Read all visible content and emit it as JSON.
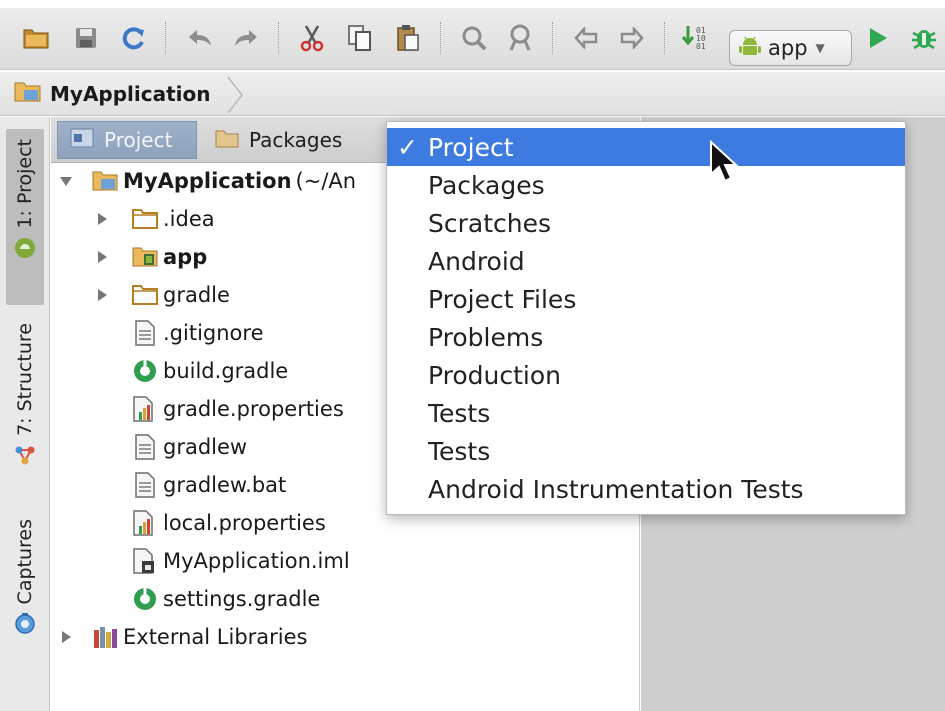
{
  "toolbar": {
    "buttons": [
      {
        "name": "open-folder-icon"
      },
      {
        "name": "save-icon"
      },
      {
        "name": "sync-icon"
      },
      {
        "name": "undo-icon"
      },
      {
        "name": "redo-icon"
      },
      {
        "name": "cut-icon"
      },
      {
        "name": "copy-icon"
      },
      {
        "name": "paste-icon"
      },
      {
        "name": "find-icon"
      },
      {
        "name": "replace-icon"
      },
      {
        "name": "back-icon"
      },
      {
        "name": "forward-icon"
      },
      {
        "name": "make-project-icon"
      }
    ],
    "run_config": {
      "label": "app",
      "icon": "android-icon"
    },
    "run_icon": "run-icon",
    "debug_icon": "debug-icon"
  },
  "breadcrumb": {
    "label": "MyApplication"
  },
  "tool_strip": {
    "tabs": [
      {
        "label": "1: Project",
        "icon": "android-icon",
        "active": true
      },
      {
        "label": "7: Structure",
        "icon": "structure-icon",
        "active": false
      },
      {
        "label": "Captures",
        "icon": "captures-icon",
        "active": false
      }
    ]
  },
  "panel": {
    "tabs": [
      {
        "label": "Project",
        "icon": "project-view-icon",
        "selected": true
      },
      {
        "label": "Packages",
        "icon": "packages-view-icon",
        "selected": false
      }
    ],
    "root": {
      "label": "MyApplication",
      "suffix": "(~/An"
    },
    "tree": [
      {
        "label": ".idea",
        "type": "folder",
        "expandable": true,
        "bold": false
      },
      {
        "label": "app",
        "type": "module",
        "expandable": true,
        "bold": true
      },
      {
        "label": "gradle",
        "type": "folder",
        "expandable": true,
        "bold": false
      },
      {
        "label": ".gitignore",
        "type": "text-file",
        "expandable": false,
        "bold": false
      },
      {
        "label": "build.gradle",
        "type": "gradle-file",
        "expandable": false,
        "bold": false
      },
      {
        "label": "gradle.properties",
        "type": "properties-file",
        "expandable": false,
        "bold": false
      },
      {
        "label": "gradlew",
        "type": "text-file",
        "expandable": false,
        "bold": false
      },
      {
        "label": "gradlew.bat",
        "type": "text-file",
        "expandable": false,
        "bold": false
      },
      {
        "label": "local.properties",
        "type": "properties-file",
        "expandable": false,
        "bold": false
      },
      {
        "label": "MyApplication.iml",
        "type": "iml-file",
        "expandable": false,
        "bold": false
      },
      {
        "label": "settings.gradle",
        "type": "gradle-file",
        "expandable": false,
        "bold": false
      }
    ],
    "external": {
      "label": "External Libraries"
    }
  },
  "menu": {
    "check_glyph": "✓",
    "items": [
      {
        "label": "Project",
        "selected": true
      },
      {
        "label": "Packages",
        "selected": false
      },
      {
        "label": "Scratches",
        "selected": false
      },
      {
        "label": "Android",
        "selected": false
      },
      {
        "label": "Project Files",
        "selected": false
      },
      {
        "label": "Problems",
        "selected": false
      },
      {
        "label": "Production",
        "selected": false
      },
      {
        "label": "Tests",
        "selected": false
      },
      {
        "label": "Tests",
        "selected": false
      },
      {
        "label": "Android Instrumentation Tests",
        "selected": false
      }
    ]
  },
  "colors": {
    "selection": "#3d7be0",
    "folder": "#c58a2d",
    "gradle": "#2f9e4f",
    "android": "#8fb83a"
  }
}
